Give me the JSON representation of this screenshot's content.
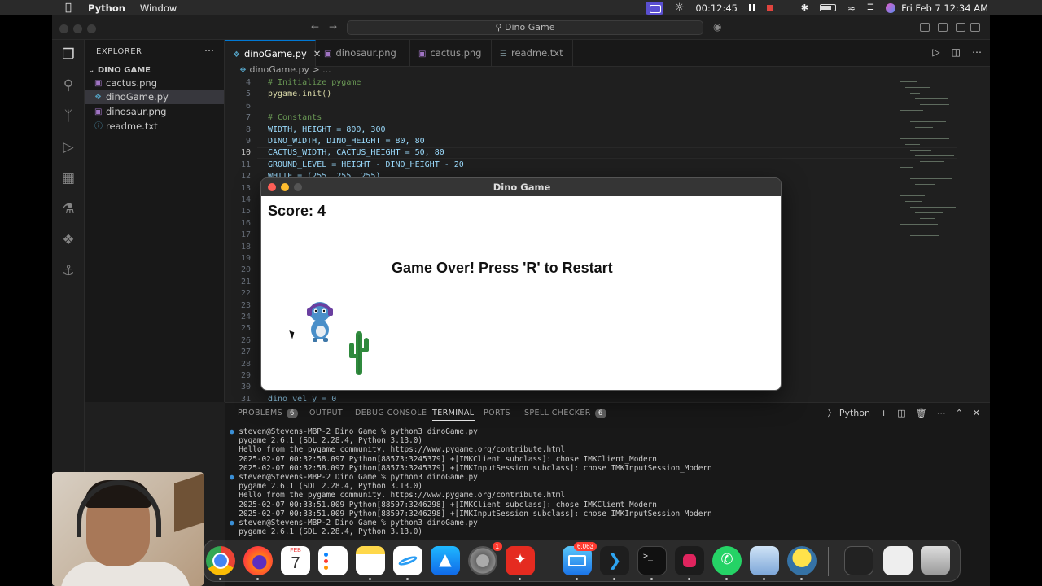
{
  "menubar": {
    "app": "Python",
    "menu_window": "Window",
    "timer": "00:12:45",
    "date": "Fri Feb 7  12:34 AM"
  },
  "vscode": {
    "command_center": "Dino Game",
    "explorer_title": "EXPLORER",
    "folder": "DINO GAME",
    "files": [
      {
        "name": "cactus.png",
        "icon": "image-file-icon"
      },
      {
        "name": "dinoGame.py",
        "icon": "python-file-icon",
        "selected": true
      },
      {
        "name": "dinosaur.png",
        "icon": "image-file-icon"
      },
      {
        "name": "readme.txt",
        "icon": "info-file-icon"
      }
    ],
    "tabs": [
      {
        "label": "dinoGame.py",
        "active": true
      },
      {
        "label": "dinosaur.png"
      },
      {
        "label": "cactus.png"
      },
      {
        "label": "readme.txt"
      }
    ],
    "breadcrumb": {
      "file": "dinoGame.py",
      "rest": "> ..."
    },
    "lines": [
      {
        "n": "4",
        "code": "# Initialize pygame",
        "kind": "comment"
      },
      {
        "n": "5",
        "code": "pygame.init()",
        "kind": "call"
      },
      {
        "n": "6",
        "code": "",
        "kind": "plain"
      },
      {
        "n": "7",
        "code": "# Constants",
        "kind": "comment"
      },
      {
        "n": "8",
        "code": "WIDTH, HEIGHT = 800, 300",
        "kind": "plain"
      },
      {
        "n": "9",
        "code": "DINO_WIDTH, DINO_HEIGHT = 80, 80",
        "kind": "plain"
      },
      {
        "n": "10",
        "code": "CACTUS_WIDTH, CACTUS_HEIGHT = 50, 80",
        "kind": "plain"
      },
      {
        "n": "11",
        "code": "GROUND_LEVEL = HEIGHT - DINO_HEIGHT - 20",
        "kind": "plain"
      },
      {
        "n": "12",
        "code": "WHITE = (255, 255, 255)",
        "kind": "plain"
      },
      {
        "n": "13",
        "code": "",
        "kind": "plain"
      },
      {
        "n": "14",
        "code": "",
        "kind": "plain"
      },
      {
        "n": "15",
        "code": "",
        "kind": "plain"
      },
      {
        "n": "16",
        "code": "",
        "kind": "plain"
      },
      {
        "n": "17",
        "code": "",
        "kind": "plain"
      },
      {
        "n": "18",
        "code": "",
        "kind": "plain"
      },
      {
        "n": "19",
        "code": "",
        "kind": "plain"
      },
      {
        "n": "20",
        "code": "",
        "kind": "plain"
      },
      {
        "n": "21",
        "code": "",
        "kind": "plain"
      },
      {
        "n": "22",
        "code": "",
        "kind": "plain"
      },
      {
        "n": "23",
        "code": "",
        "kind": "plain"
      },
      {
        "n": "24",
        "code": "",
        "kind": "plain"
      },
      {
        "n": "25",
        "code": "",
        "kind": "plain"
      },
      {
        "n": "26",
        "code": "",
        "kind": "plain"
      },
      {
        "n": "27",
        "code": "",
        "kind": "plain"
      },
      {
        "n": "28",
        "code": "",
        "kind": "plain"
      },
      {
        "n": "29",
        "code": "",
        "kind": "plain"
      },
      {
        "n": "30",
        "code": "",
        "kind": "plain"
      },
      {
        "n": "31",
        "code": "dino_vel_y = 0",
        "kind": "plain"
      }
    ],
    "current_line": "10",
    "panel_tabs": [
      {
        "label": "PROBLEMS",
        "badge": "6"
      },
      {
        "label": "OUTPUT"
      },
      {
        "label": "DEBUG CONSOLE"
      },
      {
        "label": "TERMINAL",
        "active": true
      },
      {
        "label": "PORTS"
      },
      {
        "label": "SPELL CHECKER",
        "badge": "6"
      }
    ],
    "terminal_profile": "Python",
    "terminal_lines": [
      "steven@Stevens-MBP-2 Dino Game % python3 dinoGame.py",
      "pygame 2.6.1 (SDL 2.28.4, Python 3.13.0)",
      "Hello from the pygame community. https://www.pygame.org/contribute.html",
      "2025-02-07 00:32:58.097 Python[88573:3245379] +[IMKClient subclass]: chose IMKClient_Modern",
      "2025-02-07 00:32:58.097 Python[88573:3245379] +[IMKInputSession subclass]: chose IMKInputSession_Modern",
      "steven@Stevens-MBP-2 Dino Game % python3 dinoGame.py",
      "pygame 2.6.1 (SDL 2.28.4, Python 3.13.0)",
      "Hello from the pygame community. https://www.pygame.org/contribute.html",
      "2025-02-07 00:33:51.009 Python[88597:3246298] +[IMKClient subclass]: chose IMKClient_Modern",
      "2025-02-07 00:33:51.009 Python[88597:3246298] +[IMKInputSession subclass]: chose IMKInputSession_Modern",
      "steven@Stevens-MBP-2 Dino Game % python3 dinoGame.py",
      "pygame 2.6.1 (SDL 2.28.4, Python 3.13.0)"
    ],
    "prompt_lines": [
      0,
      5,
      10
    ]
  },
  "game": {
    "title": "Dino Game",
    "score": "Score: 4",
    "message": "Game Over! Press 'R' to Restart"
  },
  "dock": {
    "calendar_month": "FEB",
    "calendar_day": "7",
    "settings_badge": "1",
    "mail_badge": "6,063",
    "apps": [
      "chrome-icon",
      "firefox-icon",
      "calendar-icon",
      "reminders-icon",
      "notes-icon",
      "freeform-icon",
      "app-store-icon",
      "system-settings-icon",
      "acrobat-icon",
      "mail-icon",
      "vscode-icon",
      "terminal-icon",
      "screen-recorder-icon",
      "whatsapp-icon",
      "preview-icon",
      "python-launcher-icon",
      "trash-icon"
    ]
  }
}
